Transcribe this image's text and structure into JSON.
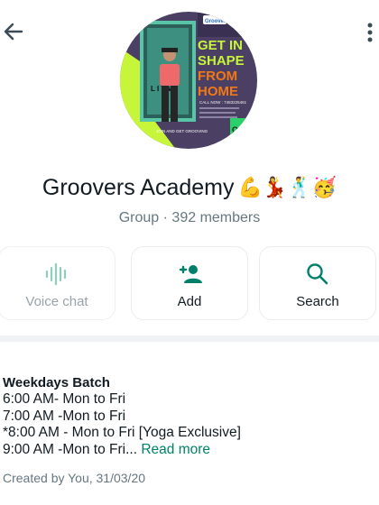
{
  "header": {
    "back_icon": "arrow-back-icon",
    "menu_icon": "more-vertical-icon"
  },
  "avatar": {
    "badge_text": "Groovers",
    "headline": [
      "GET IN",
      "SHAPE",
      "FROM",
      "HOME"
    ],
    "call_text": "CALL NOW : 7483225461",
    "footer_text": "JOIN AND GET GROOVING",
    "corner_text": "Onli",
    "board_text": "L I V W",
    "colors": {
      "green": "#c6f53a",
      "orange": "#f07818",
      "purple": "#4b3f63"
    }
  },
  "group": {
    "name": "Groovers Academy",
    "emojis": "💪💃🕺🥳",
    "meta": "Group · 392 members"
  },
  "actions": {
    "voice_chat": {
      "label": "Voice chat",
      "icon": "voice-waveform-icon",
      "enabled": false
    },
    "add": {
      "label": "Add",
      "icon": "add-person-icon"
    },
    "search": {
      "label": "Search",
      "icon": "search-icon"
    }
  },
  "description": {
    "title": "Weekdays Batch",
    "lines": [
      "6:00 AM- Mon to Fri",
      "7:00 AM -Mon to Fri",
      "*8:00 AM - Mon to Fri [Yoga Exclusive]",
      "9:00 AM -Mon to Fri..."
    ],
    "read_more": "Read more",
    "created": "Created by You, 31/03/20"
  },
  "colors": {
    "accent": "#008069",
    "muted": "#667781",
    "background": "#f0f2f5"
  }
}
